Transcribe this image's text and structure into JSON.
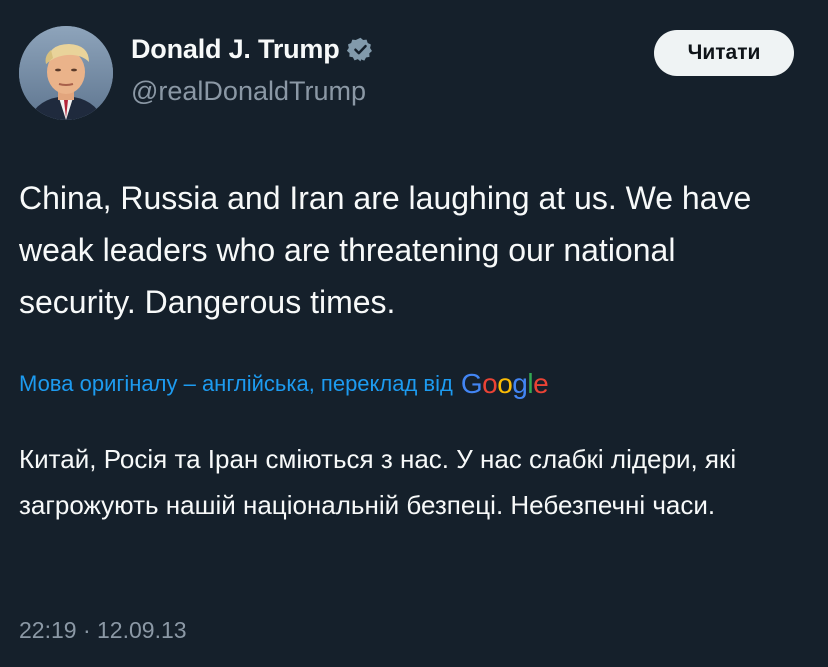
{
  "author": {
    "display_name": "Donald J. Trump",
    "handle": "@realDonaldTrump",
    "verified_icon": "verified-badge-icon",
    "badge_color": "#829aab"
  },
  "follow_button": {
    "label": "Читати"
  },
  "tweet": {
    "text": "China, Russia and Iran are laughing at us. We have weak leaders who are threatening our national security. Dangerous times."
  },
  "translation": {
    "label": "Мова оригіналу – англійська, переклад від",
    "provider": "Google",
    "text": "Китай, Росія та Іран сміються з нас. У нас слабкі лідери, які загрожують нашій національній безпеці. Небезпечні часи."
  },
  "timestamp": {
    "time": "22:19",
    "separator": " · ",
    "date": "12.09.13"
  },
  "colors": {
    "background": "#15202b",
    "text_primary": "#f7f9f9",
    "text_secondary": "#8b98a5",
    "link": "#1d9bf0",
    "button_bg": "#eff3f4"
  }
}
